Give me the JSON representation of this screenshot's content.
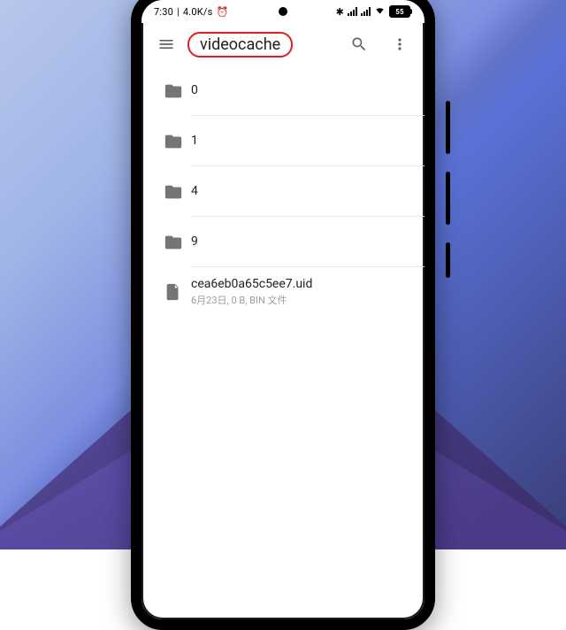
{
  "status": {
    "time": "7:30",
    "net_speed": "4.0K/s",
    "battery_label": "55"
  },
  "appbar": {
    "title": "videocache"
  },
  "items": [
    {
      "kind": "folder",
      "name": "0"
    },
    {
      "kind": "folder",
      "name": "1"
    },
    {
      "kind": "folder",
      "name": "4"
    },
    {
      "kind": "folder",
      "name": "9"
    },
    {
      "kind": "file",
      "name": "cea6eb0a65c5ee7.uid",
      "meta": "6月23日, 0 B, BIN 文件"
    }
  ]
}
